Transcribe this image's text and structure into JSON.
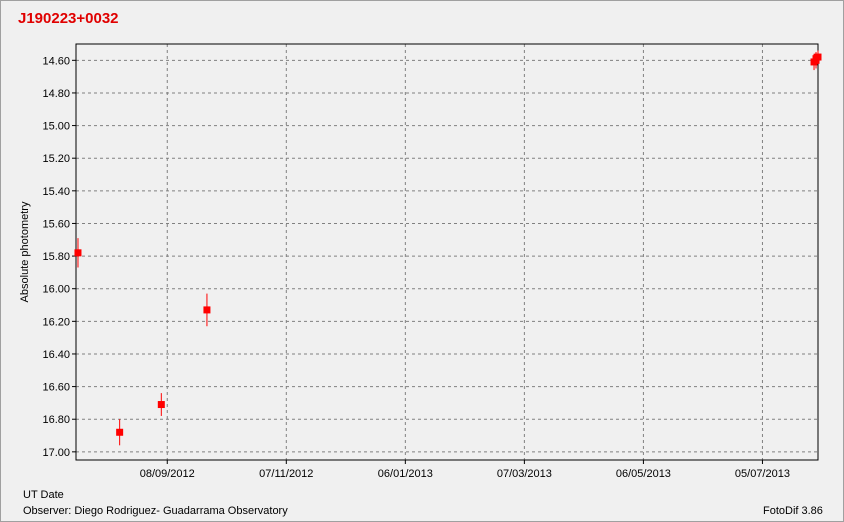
{
  "chart_data": {
    "type": "scatter",
    "title": "J190223+0032",
    "xlabel": "UT Date",
    "ylabel": "Absolute photometry",
    "x_ticks": [
      "08/09/2012",
      "07/11/2012",
      "06/01/2013",
      "07/03/2013",
      "06/05/2013",
      "05/07/2013"
    ],
    "y_ticks": [
      "14.60",
      "14.80",
      "15.00",
      "15.20",
      "15.40",
      "15.60",
      "15.80",
      "16.00",
      "16.20",
      "16.40",
      "16.60",
      "16.80",
      "17.00"
    ],
    "xlim": [
      "2012-07-24",
      "2013-08-02"
    ],
    "ylim": [
      17.05,
      14.5
    ],
    "y_inverted": true,
    "grid": true,
    "marker_color": "#ff0000",
    "points": [
      {
        "x": "2012-07-25",
        "y": 15.78,
        "err": 0.09
      },
      {
        "x": "2012-08-15",
        "y": 16.88,
        "err": 0.08
      },
      {
        "x": "2012-09-05",
        "y": 16.71,
        "err": 0.07
      },
      {
        "x": "2012-09-28",
        "y": 16.13,
        "err": 0.1
      },
      {
        "x": "2013-07-31",
        "y": 14.61,
        "err": 0.05
      },
      {
        "x": "2013-08-01",
        "y": 14.59,
        "err": 0.04
      },
      {
        "x": "2013-08-01",
        "y": 14.6,
        "err": 0.05
      },
      {
        "x": "2013-08-02",
        "y": 14.58,
        "err": 0.04
      }
    ]
  },
  "footer": {
    "observer": "Observer: Diego Rodriguez- Guadarrama Observatory",
    "software": "FotoDif 3.86"
  }
}
